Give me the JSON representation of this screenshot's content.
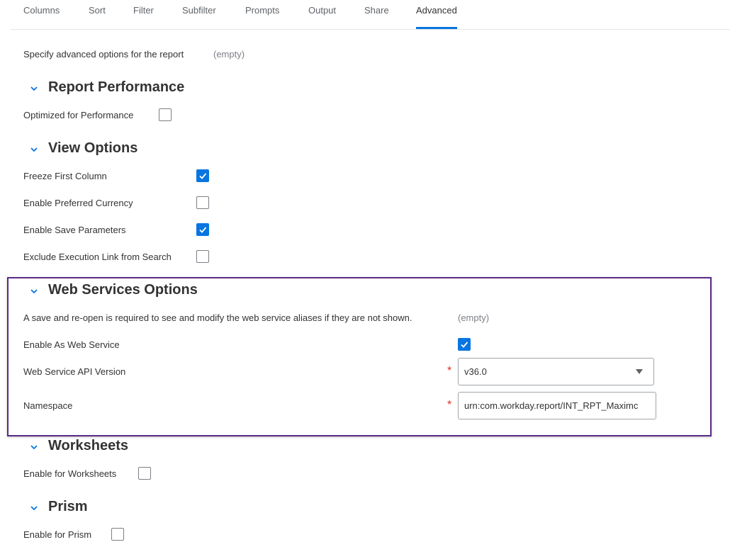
{
  "tabs": [
    "Columns",
    "Sort",
    "Filter",
    "Subfilter",
    "Prompts",
    "Output",
    "Share",
    "Advanced"
  ],
  "active_tab": "Advanced",
  "intro": {
    "label": "Specify advanced options for the report",
    "value": "(empty)"
  },
  "sections": {
    "report_performance": {
      "title": "Report Performance",
      "fields": {
        "optimized": {
          "label": "Optimized for Performance",
          "checked": false
        }
      }
    },
    "view_options": {
      "title": "View Options",
      "fields": {
        "freeze_first_column": {
          "label": "Freeze First Column",
          "checked": true
        },
        "preferred_currency": {
          "label": "Enable Preferred Currency",
          "checked": false
        },
        "save_parameters": {
          "label": "Enable Save Parameters",
          "checked": true
        },
        "exclude_execution_link": {
          "label": "Exclude Execution Link from Search",
          "checked": false
        }
      }
    },
    "web_services": {
      "title": "Web Services Options",
      "note": "A save and re-open is required to see and modify the web service aliases if they are not shown.",
      "note_value": "(empty)",
      "enable_web_service": {
        "label": "Enable As Web Service",
        "checked": true
      },
      "api_version": {
        "label": "Web Service API Version",
        "value": "v36.0",
        "required_mark": "*"
      },
      "namespace": {
        "label": "Namespace",
        "value": "urn:com.workday.report/INT_RPT_Maximc",
        "required_mark": "*"
      }
    },
    "worksheets": {
      "title": "Worksheets",
      "fields": {
        "enable_worksheets": {
          "label": "Enable for Worksheets",
          "checked": false
        }
      }
    },
    "prism": {
      "title": "Prism",
      "fields": {
        "enable_prism": {
          "label": "Enable for Prism",
          "checked": false
        }
      }
    }
  },
  "colors": {
    "accent": "#0875e1",
    "highlight_border": "#5b2a86",
    "required": "#de2e21"
  }
}
